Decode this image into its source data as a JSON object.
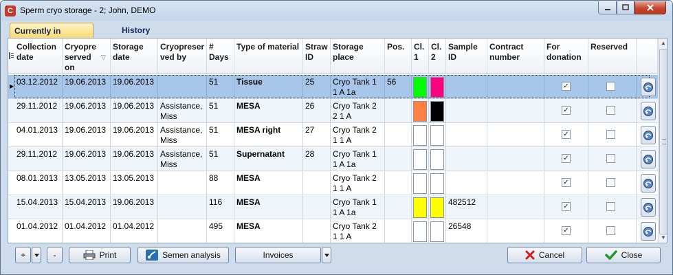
{
  "window": {
    "title": "Sperm cryo storage - 2; John, DEMO"
  },
  "tabs": [
    {
      "label": "Currently in storage",
      "active": true
    },
    {
      "label": "History",
      "active": false
    }
  ],
  "columns": [
    "Collection\ndate",
    "Cryopre\nserved\non",
    "Storage\ndate",
    "Cryopreser\nved by",
    "#\nDays",
    "Type of material",
    "Straw\nID",
    "Storage\nplace",
    "Pos.",
    "Cl.\n1",
    "Cl.\n2",
    "Sample\nID",
    "Contract\nnumber",
    "For\ndonation",
    "Reserved"
  ],
  "rows": [
    {
      "collection": "03.12.2012",
      "cryo": "19.06.2013",
      "storage": "19.06.2013",
      "by": "",
      "days": "51",
      "material": "Tissue",
      "straw": "25",
      "place": "Cryo Tank 1 1 A 1a",
      "pos": "56",
      "cl1": "#00ff00",
      "cl2": "#ff0080",
      "sample": "",
      "contract": "",
      "donation": true,
      "reserved": false
    },
    {
      "collection": "29.11.2012",
      "cryo": "19.06.2013",
      "storage": "19.06.2013",
      "by": "Assistance, Miss",
      "days": "51",
      "material": "MESA",
      "straw": "26",
      "place": "Cryo Tank 2 2 1 A",
      "pos": "",
      "cl1": "#ff8040",
      "cl2": "#000000",
      "sample": "",
      "contract": "",
      "donation": true,
      "reserved": false
    },
    {
      "collection": "04.01.2013",
      "cryo": "19.06.2013",
      "storage": "19.06.2013",
      "by": "Assistance, Miss",
      "days": "51",
      "material": "MESA right",
      "straw": "27",
      "place": "Cryo Tank 2 1 1 A",
      "pos": "",
      "cl1": "#ffffff",
      "cl2": "#ffffff",
      "sample": "",
      "contract": "",
      "donation": true,
      "reserved": false
    },
    {
      "collection": "29.11.2012",
      "cryo": "19.06.2013",
      "storage": "19.06.2013",
      "by": "Assistance, Miss",
      "days": "51",
      "material": "Supernatant",
      "straw": "28",
      "place": "Cryo Tank 1 1 A 1a",
      "pos": "",
      "cl1": "#ffffff",
      "cl2": "#ffffff",
      "sample": "",
      "contract": "",
      "donation": true,
      "reserved": false
    },
    {
      "collection": "08.01.2013",
      "cryo": "13.05.2013",
      "storage": "13.05.2013",
      "by": "",
      "days": "88",
      "material": "MESA",
      "straw": "",
      "place": "Cryo Tank 2 1 1 A",
      "pos": "",
      "cl1": "#ffffff",
      "cl2": "#ffffff",
      "sample": "",
      "contract": "",
      "donation": true,
      "reserved": false
    },
    {
      "collection": "15.04.2013",
      "cryo": "15.04.2013",
      "storage": "19.06.2013",
      "by": "",
      "days": "116",
      "material": "MESA",
      "straw": "",
      "place": "Cryo Tank 1 1 A 1a",
      "pos": "",
      "cl1": "#ffff00",
      "cl2": "#ffff00",
      "sample": "482512",
      "contract": "",
      "donation": true,
      "reserved": false
    },
    {
      "collection": "01.04.2012",
      "cryo": "01.04.2012",
      "storage": "01.04.2012",
      "by": "",
      "days": "495",
      "material": "MESA",
      "straw": "",
      "place": "Cryo Tank 2 1 1 A",
      "pos": "",
      "cl1": "#ffffff",
      "cl2": "#ffffff",
      "sample": "26548",
      "contract": "",
      "donation": true,
      "reserved": false
    }
  ],
  "buttons": {
    "add": "+",
    "remove": "-",
    "print": "Print",
    "semen": "Semen analysis",
    "invoices": "Invoices",
    "cancel": "Cancel",
    "close": "Close"
  }
}
